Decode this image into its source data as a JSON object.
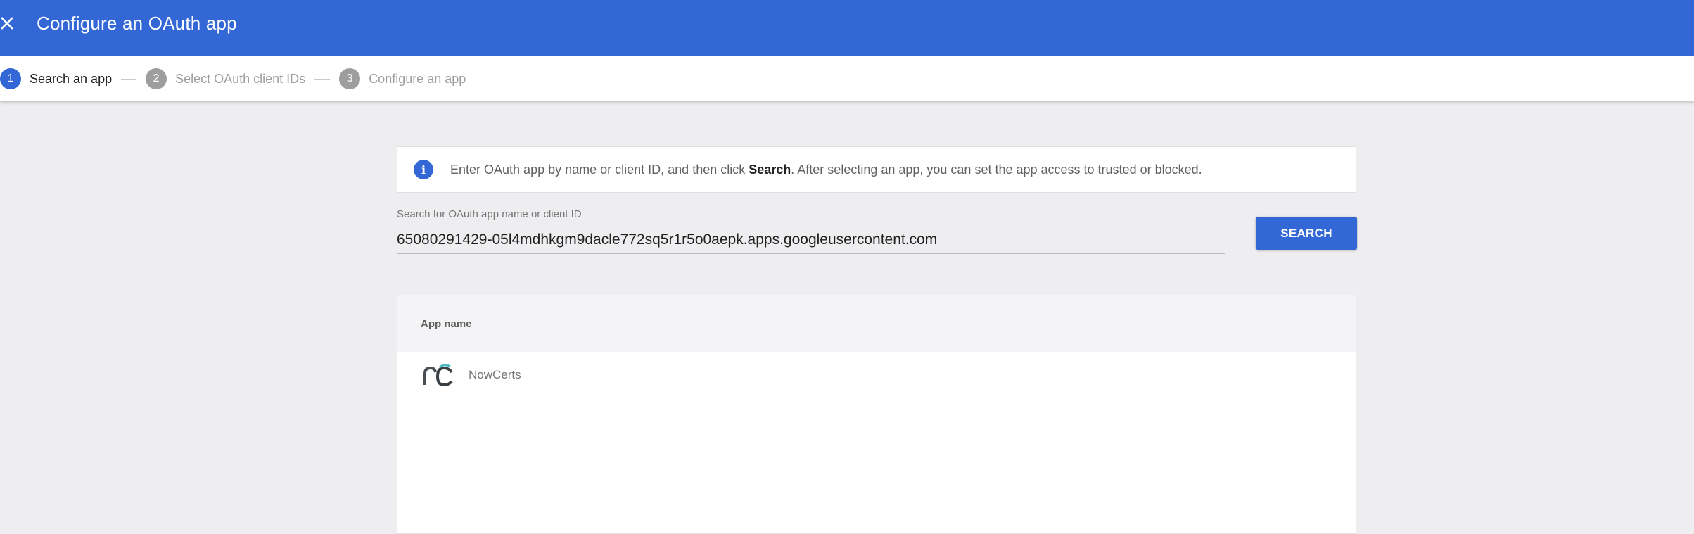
{
  "header": {
    "close_icon": "close-icon",
    "title": "Configure an OAuth app"
  },
  "stepper": {
    "steps": [
      {
        "number": "1",
        "label": "Search an app",
        "state": "active"
      },
      {
        "number": "2",
        "label": "Select OAuth client IDs",
        "state": "inactive"
      },
      {
        "number": "3",
        "label": "Configure an app",
        "state": "inactive"
      }
    ]
  },
  "info": {
    "icon": "info-icon",
    "text_before": "Enter OAuth app by name or client ID, and then click ",
    "text_bold": "Search",
    "text_after": ". After selecting an app, you can set the app access to trusted or blocked."
  },
  "search": {
    "label": "Search for OAuth app name or client ID",
    "value": "65080291429-05l4mdhkgm9dacle772sq5r1r5o0aepk.apps.googleusercontent.com",
    "button_label": "SEARCH"
  },
  "results": {
    "column_header": "App name",
    "rows": [
      {
        "name": "NowCerts",
        "logo": "nowcerts-logo"
      }
    ]
  },
  "colors": {
    "primary": "#3367d6",
    "background": "#eeeef0",
    "inactive_step": "#9e9e9e"
  }
}
